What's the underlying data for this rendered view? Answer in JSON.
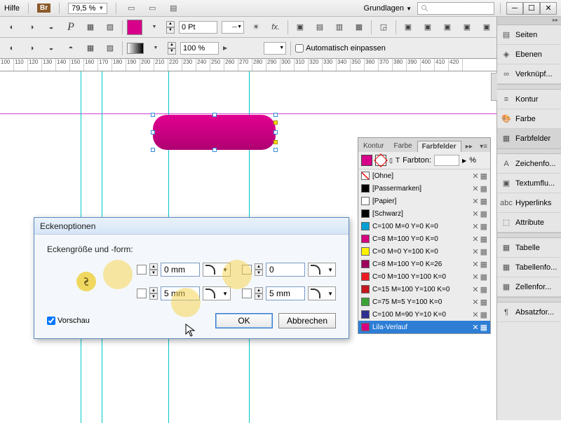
{
  "menubar": {
    "help": "Hilfe",
    "br": "Br",
    "zoom": "79,5 %",
    "workspace": "Grundlagen",
    "search_placeholder": ""
  },
  "toolbar": {
    "stroke_weight": "0 Pt",
    "opacity": "100 %",
    "autofit_label": "Automatisch einpassen"
  },
  "ruler_values": [
    "100",
    "110",
    "120",
    "130",
    "140",
    "150",
    "160",
    "170",
    "180",
    "190",
    "200",
    "210",
    "220",
    "230",
    "240",
    "250",
    "260",
    "270",
    "280",
    "290",
    "300",
    "310",
    "320",
    "330",
    "340",
    "350",
    "360",
    "370",
    "380",
    "390",
    "400",
    "410",
    "420"
  ],
  "right_panels": {
    "groups": [
      [
        "Seiten",
        "Ebenen",
        "Verknüpf..."
      ],
      [
        "Kontur",
        "Farbe",
        "Farbfelder"
      ],
      [
        "Zeichenfo...",
        "Textumflu...",
        "Hyperlinks",
        "Attribute"
      ],
      [
        "Tabelle",
        "Tabellenfo...",
        "Zellenfor..."
      ],
      [
        "Absatzfor..."
      ]
    ],
    "active": "Farbfelder"
  },
  "swatches": {
    "tabs": [
      "Kontur",
      "Farbe",
      "Farbfelder"
    ],
    "active_tab": "Farbfelder",
    "tint_label": "Farbton:",
    "tint_value": "",
    "tint_unit": "%",
    "rows": [
      {
        "name": "[Ohne]",
        "color": "none"
      },
      {
        "name": "[Passermarken]",
        "color": "#000"
      },
      {
        "name": "[Papier]",
        "color": "#fff"
      },
      {
        "name": "[Schwarz]",
        "color": "#000"
      },
      {
        "name": "C=100 M=0 Y=0 K=0",
        "color": "#00a0d2"
      },
      {
        "name": "C=8 M=100 Y=0 K=0",
        "color": "#d6007e"
      },
      {
        "name": "C=0 M=0 Y=100 K=0",
        "color": "#fff200"
      },
      {
        "name": "C=8 M=100 Y=0 K=26",
        "color": "#9e005d"
      },
      {
        "name": "C=0 M=100 Y=100 K=0",
        "color": "#ed1c24"
      },
      {
        "name": "C=15 M=100 Y=100 K=0",
        "color": "#c4161c"
      },
      {
        "name": "C=75 M=5 Y=100 K=0",
        "color": "#3aa535"
      },
      {
        "name": "C=100 M=90 Y=10 K=0",
        "color": "#2e3192"
      },
      {
        "name": "Lila-Verlauf",
        "color": "#d6007e",
        "selected": true
      }
    ]
  },
  "dialog": {
    "title": "Eckenoptionen",
    "subtitle": "Eckengröße und -form:",
    "corners": {
      "tl": "0 mm",
      "tr": "0",
      "bl": "5 mm",
      "br": "5 mm"
    },
    "preview_label": "Vorschau",
    "ok": "OK",
    "cancel": "Abbrechen"
  }
}
